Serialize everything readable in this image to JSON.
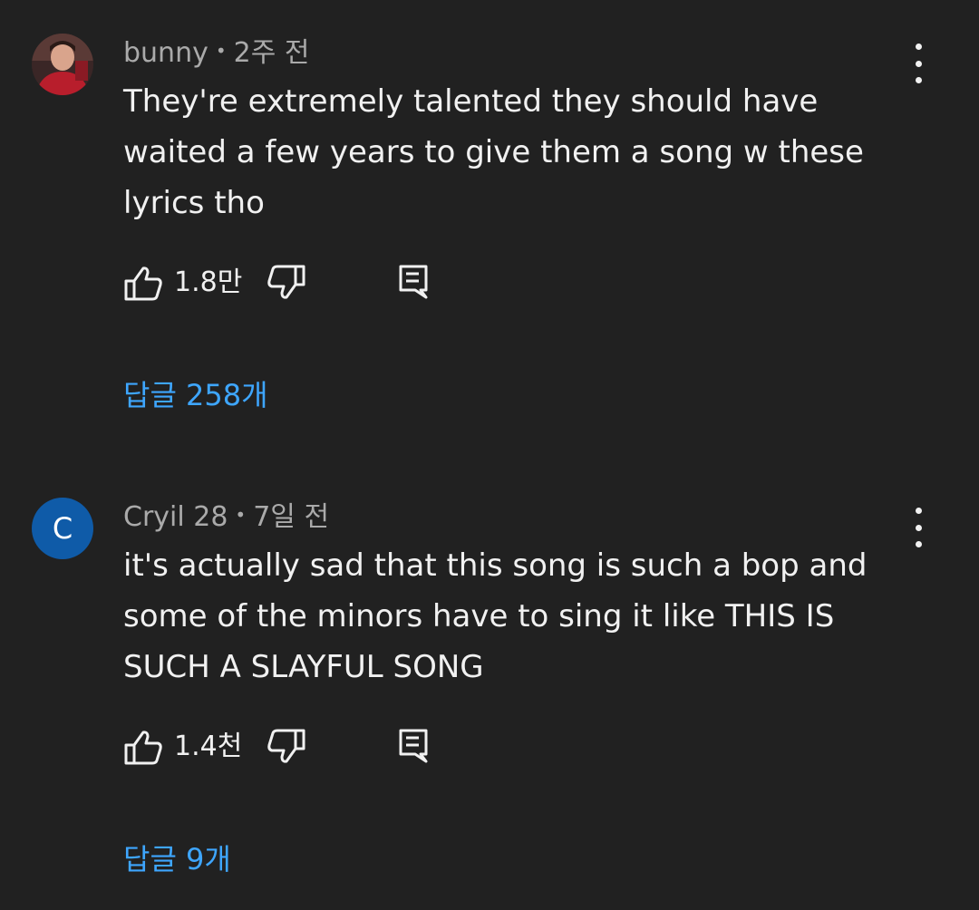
{
  "comments": [
    {
      "author": "bunny",
      "time": "2주 전",
      "text": "They're extremely talented they should have waited a few years to give them a song w these lyrics tho",
      "likes": "1.8만",
      "replies": "답글 258개",
      "avatar_type": "photo"
    },
    {
      "author": "Cryil 28",
      "time": "7일 전",
      "text": "it's actually sad that this song is such a bop and some of the minors have to sing it like THIS IS SUCH A SLAYFUL SONG",
      "likes": "1.4천",
      "replies": "답글 9개",
      "avatar_type": "letter",
      "avatar_letter": "C",
      "avatar_color": "#0f5ba8"
    }
  ],
  "icons": {
    "like": "thumbs-up-icon",
    "dislike": "thumbs-down-icon",
    "reply": "reply-comment-icon",
    "menu": "more-vertical-icon"
  },
  "colors": {
    "background": "#212121",
    "link": "#3ea6ff",
    "meta": "#aaaaaa"
  }
}
